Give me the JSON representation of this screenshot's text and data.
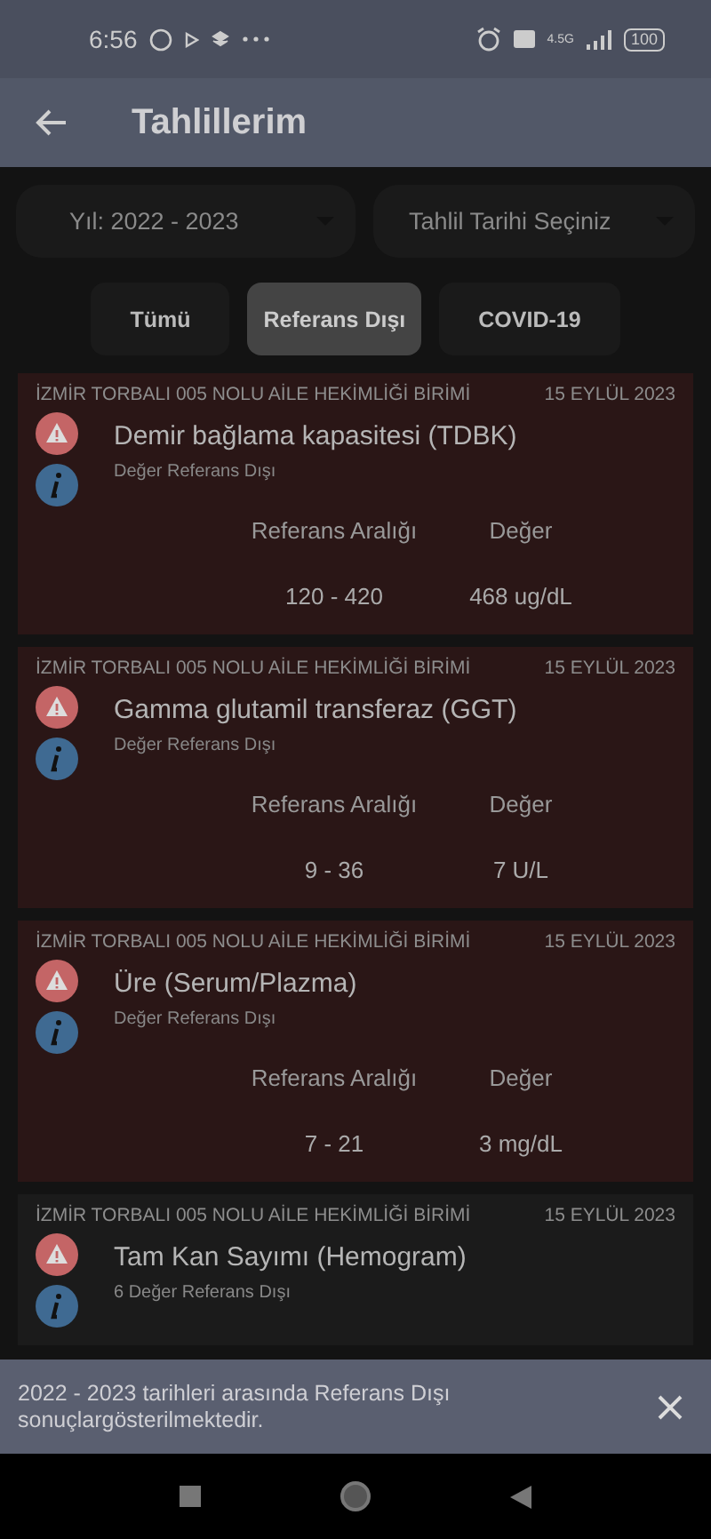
{
  "status_bar": {
    "time": "6:56",
    "network": "4.5G",
    "battery": "100"
  },
  "app_bar": {
    "title": "Tahlillerim"
  },
  "filters": [
    {
      "kind": "dropdown",
      "value": "Yıl: 2022 - 2023"
    },
    {
      "kind": "dropdown",
      "value": "Tahlil Tarihi Seçiniz"
    }
  ],
  "chips": [
    {
      "label": "Tümü",
      "selected": false
    },
    {
      "label": "Referans Dışı",
      "selected": true
    },
    {
      "label": "COVID-19",
      "selected": false
    }
  ],
  "results": [
    {
      "facility": "İZMİR TORBALI 005 NOLU AİLE HEKİMLİĞİ BİRİMİ",
      "date": "15 EYLÜL 2023",
      "test": "Demir bağlama kapasitesi (TDBK)",
      "note": "Değer Referans Dışı",
      "highlighted": true,
      "range_label": "Referans Aralığı",
      "value_label": "Değer",
      "range": "120 - 420",
      "value": "468  ug/dL"
    },
    {
      "facility": "İZMİR TORBALI 005 NOLU AİLE HEKİMLİĞİ BİRİMİ",
      "date": "15 EYLÜL 2023",
      "test": "Gamma glutamil transferaz (GGT)",
      "note": "Değer Referans Dışı",
      "highlighted": true,
      "range_label": "Referans Aralığı",
      "value_label": "Değer",
      "range": "9 - 36",
      "value": "7  U/L"
    },
    {
      "facility": "İZMİR TORBALI 005 NOLU AİLE HEKİMLİĞİ BİRİMİ",
      "date": "15 EYLÜL 2023",
      "test": "Üre (Serum/Plazma)",
      "note": "Değer Referans Dışı",
      "highlighted": true,
      "range_label": "Referans Aralığı",
      "value_label": "Değer",
      "range": "7 - 21",
      "value": "3  mg/dL"
    },
    {
      "facility": "İZMİR TORBALI 005 NOLU AİLE HEKİMLİĞİ BİRİMİ",
      "date": "15 EYLÜL 2023",
      "test": "Tam Kan Sayımı (Hemogram)",
      "note": "6 Değer Referans Dışı",
      "highlighted": false
    }
  ],
  "snackbar": {
    "message": "2022 - 2023 tarihleri arasında Referans Dışı sonuçlargösterilmektedir."
  }
}
